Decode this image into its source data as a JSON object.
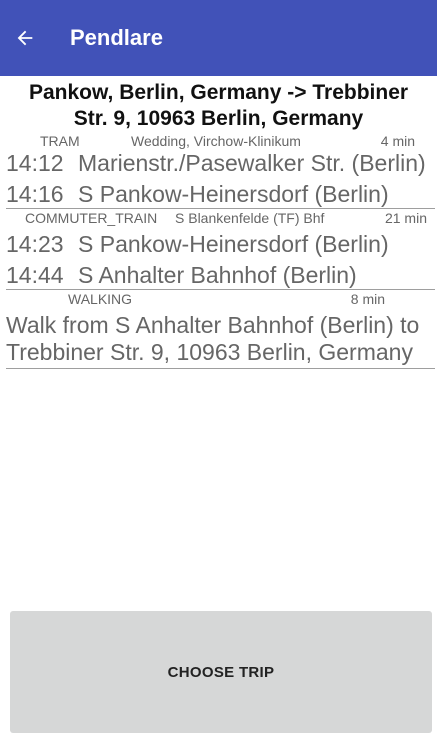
{
  "app_bar": {
    "title": "Pendlare",
    "back_icon": "arrow-left-icon",
    "color": "#4152b8"
  },
  "trip": {
    "title": "Pankow, Berlin, Germany -> Trebbiner Str. 9, 10963 Berlin, Germany",
    "legs": [
      {
        "mode": "TRAM",
        "direction": "Wedding, Virchow-Klinikum",
        "duration": "4 min",
        "stops": [
          {
            "time": "14:12",
            "name": "Marienstr./Pasewalker Str. (Berlin)"
          },
          {
            "time": "14:16",
            "name": "S Pankow-Heinersdorf (Berlin)"
          }
        ]
      },
      {
        "mode": "COMMUTER_TRAIN",
        "direction": "S Blankenfelde (TF) Bhf",
        "duration": "21 min",
        "stops": [
          {
            "time": "14:23",
            "name": "S Pankow-Heinersdorf (Berlin)"
          },
          {
            "time": "14:44",
            "name": "S Anhalter Bahnhof (Berlin)"
          }
        ]
      },
      {
        "mode": "WALKING",
        "direction": "",
        "duration": "8 min",
        "description": "Walk from S Anhalter Bahnhof (Berlin) to Trebbiner Str. 9, 10963 Berlin, Germany"
      }
    ]
  },
  "choose_button": {
    "label": "CHOOSE TRIP"
  }
}
